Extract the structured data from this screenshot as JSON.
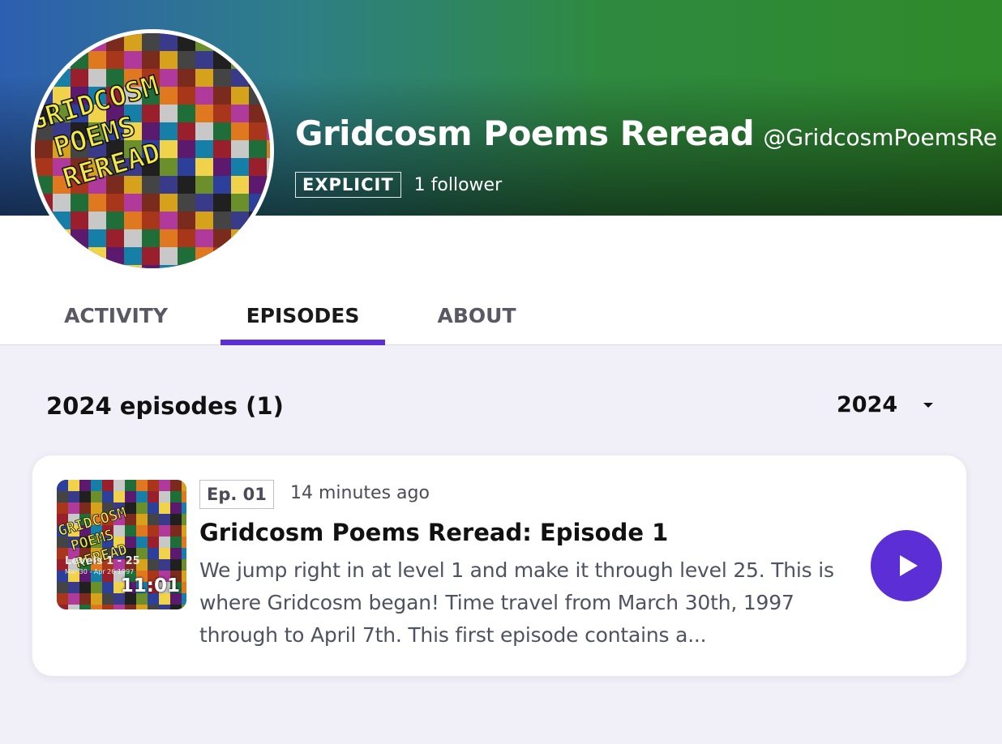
{
  "header": {
    "title": "Gridcosm Poems Reread",
    "handle": "@GridcosmPoemsRe",
    "explicit_badge": "EXPLICIT",
    "followers": "1 follower"
  },
  "tabs": [
    {
      "label": "ACTIVITY",
      "active": false
    },
    {
      "label": "EPISODES",
      "active": true
    },
    {
      "label": "ABOUT",
      "active": false
    }
  ],
  "episodes_section": {
    "heading": "2024 episodes (1)",
    "year_selected": "2024",
    "icons": {
      "year_dropdown": "caret-down-icon"
    }
  },
  "episodes": [
    {
      "badge": "Ep. 01",
      "time_ago": "14 minutes ago",
      "title": "Gridcosm Poems Reread: Episode 1",
      "description": "We jump right in at level 1 and make it through level 25. This is where Gridcosm began! Time travel from March 30th, 1997 through to April 7th. This first episode contains a...",
      "duration": "11:01",
      "play_icon": "play-icon"
    }
  ],
  "artwork": {
    "avatar_text": [
      "GRIDCOSM",
      "POEMS",
      "REREAD"
    ],
    "thumb_text": [
      "GRIDCOSM",
      "POEMS",
      "REREAD"
    ],
    "thumb_subtitle": "Levels 1 - 25",
    "thumb_dates": "Mar 30 - Apr 26 1997"
  },
  "colors": {
    "accent": "#5b2ed6",
    "banner_left": "#2d5fb0",
    "banner_right": "#2f8a2a",
    "page_bg": "#f1eff7"
  }
}
